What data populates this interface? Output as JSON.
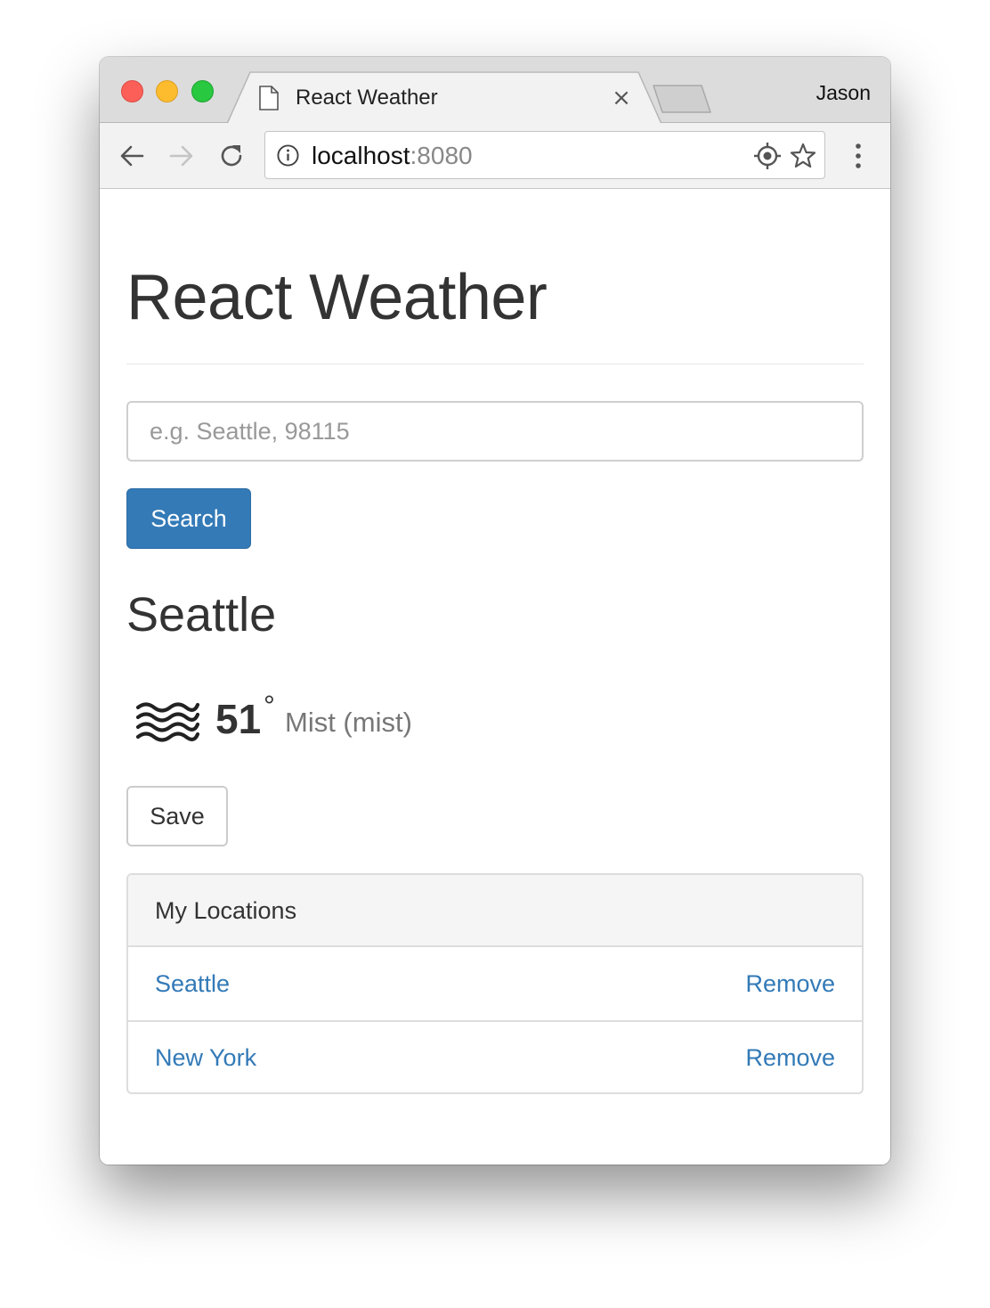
{
  "browser": {
    "tab": {
      "title": "React Weather",
      "close_glyph": "×"
    },
    "profile_name": "Jason",
    "url": {
      "host": "localhost",
      "port": ":8080"
    }
  },
  "page": {
    "title": "React Weather",
    "search": {
      "placeholder": "e.g. Seattle, 98115",
      "value": "",
      "button_label": "Search"
    },
    "current": {
      "city": "Seattle",
      "icon": "mist-icon",
      "temperature": "51",
      "degree_symbol": "°",
      "description": "Mist (mist)"
    },
    "save_label": "Save",
    "locations": {
      "heading": "My Locations",
      "items": [
        {
          "name": "Seattle",
          "remove_label": "Remove"
        },
        {
          "name": "New York",
          "remove_label": "Remove"
        }
      ]
    }
  },
  "colors": {
    "primary": "#337ab7",
    "text": "#333333",
    "muted": "#777777"
  }
}
